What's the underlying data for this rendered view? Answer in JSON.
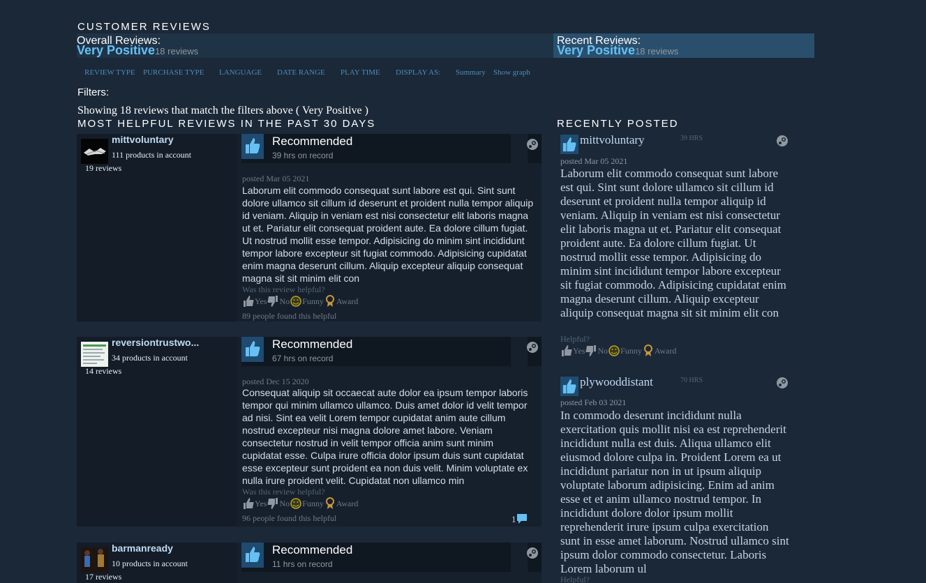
{
  "section_title": "CUSTOMER REVIEWS",
  "overall": {
    "label": "Overall Reviews:",
    "score": "Very Positive",
    "count": "18 reviews"
  },
  "recent": {
    "label": "Recent Reviews:",
    "score": "Very Positive",
    "count": "18 reviews"
  },
  "filters": {
    "review_type": "REVIEW TYPE",
    "purchase_type": "PURCHASE TYPE",
    "language": "LANGUAGE",
    "date_range": "DATE RANGE",
    "play_time": "PLAY TIME",
    "display_as": "DISPLAY AS:",
    "summary": "Summary",
    "show_graph": "Show graph",
    "filters_label": "Filters:",
    "showing": "Showing 18 reviews that match the filters above ( Very Positive )"
  },
  "most_helpful_title": "MOST HELPFUL REVIEWS IN THE PAST 30 DAYS",
  "recently_posted_title": "RECENTLY POSTED",
  "controls": {
    "yes": "Yes",
    "no": "No",
    "funny": "Funny",
    "award": "Award",
    "helpful_q": "Was this review helpful?",
    "helpful_short": "Helpful?"
  },
  "reviews": [
    {
      "user": "mittvoluntary",
      "products": "111 products in account",
      "reviews_count": "19 reviews",
      "verdict": "Recommended",
      "hours": "39 hrs on record",
      "posted": "posted Mar 05 2021",
      "text": "Laborum elit commodo consequat sunt labore est qui. Sint sunt dolore ullamco sit cillum id deserunt et proident nulla tempor aliquip id veniam. Aliquip in veniam est nisi consectetur elit laboris magna ut et. Pariatur elit consequat proident aute. Ea dolore cillum fugiat. Ut nostrud mollit esse tempor. Adipisicing do minim sint incididunt tempor labore excepteur sit fugiat commodo. Adipisicing cupidatat enim magna deserunt cillum. Aliquip excepteur aliquip consequat magna sit sit minim elit con",
      "found_helpful": "89 people found this helpful"
    },
    {
      "user": "reversiontrustwo...",
      "products": "34 products in account",
      "reviews_count": "14 reviews",
      "verdict": "Recommended",
      "hours": "67 hrs on record",
      "posted": "posted Dec 15 2020",
      "text": "Consequat aliquip sit occaecat aute dolor ea ipsum tempor laboris tempor qui minim ullamco ullamco. Duis amet dolor id velit tempor ad nisi. Sint ea velit Lorem tempor cupidatat anim aute cillum nostrud excepteur nisi magna dolore amet labore. Veniam consectetur nostrud in velit tempor officia anim sunt minim cupidatat esse. Culpa irure officia dolor ipsum duis sunt cupidatat esse excepteur sunt proident ea non duis velit. Minim voluptate ex nulla irure proident velit. Cupidatat non ullamco min",
      "found_helpful": "96 people found this helpful",
      "comments": "1"
    },
    {
      "user": "barmanready",
      "products": "10 products in account",
      "reviews_count": "17 reviews",
      "verdict": "Recommended",
      "hours": "11 hrs on record"
    }
  ],
  "recent_posts": [
    {
      "user": "mittvoluntary",
      "hours": "39 HRS",
      "posted": "posted Mar 05 2021",
      "text": "Laborum elit commodo consequat sunt labore est qui. Sint sunt dolore ullamco sit cillum id deserunt et proident nulla tempor aliquip id veniam. Aliquip in veniam est nisi consectetur elit laboris magna ut et. Pariatur elit consequat proident aute. Ea dolore cillum fugiat. Ut nostrud mollit esse tempor. Adipisicing do minim sint incididunt tempor labore excepteur sit fugiat commodo. Adipisicing cupidatat enim magna deserunt cillum. Aliquip excepteur aliquip consequat magna sit sit minim elit con"
    },
    {
      "user": "plywooddistant",
      "hours": "70 HRS",
      "posted": "posted Feb 03 2021",
      "text": "In commodo deserunt incididunt nulla exercitation quis mollit nisi ea est reprehenderit incididunt nulla est duis. Aliqua ullamco elit eiusmod dolore culpa in. Proident Lorem ea ut incididunt pariatur non in ut ipsum aliquip voluptate laborum adipisicing. Enim ad anim esse et et anim ullamco nostrud tempor. In incididunt dolore dolor ipsum mollit reprehenderit irure ipsum culpa exercitation sunt in esse amet laborum. Nostrud ullamco sint ipsum dolor commodo consectetur. Laboris Lorem laborum ul"
    }
  ],
  "colors": {
    "accent": "#66c0f4",
    "bg": "#1b2838",
    "card": "#16202d"
  },
  "icons": [
    "thumbs-up-icon",
    "steam-icon",
    "thumbs-down-icon",
    "funny-icon",
    "award-icon",
    "comment-icon"
  ]
}
